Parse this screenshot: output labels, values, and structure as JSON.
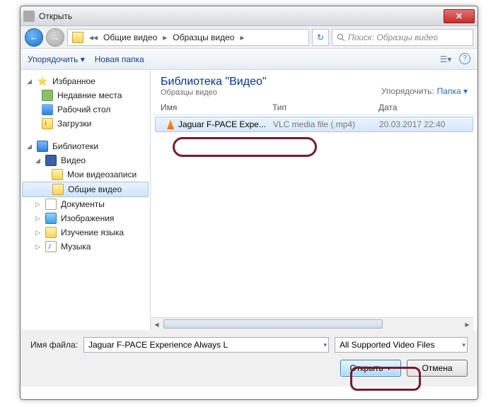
{
  "window": {
    "title": "Открыть"
  },
  "breadcrumb": {
    "seg1": "Общие видео",
    "seg2": "Образцы видео"
  },
  "search": {
    "placeholder": "Поиск: Образцы видео"
  },
  "toolbar": {
    "organize": "Упорядочить ▾",
    "newfolder": "Новая папка"
  },
  "sidebar": {
    "favorites": "Избранное",
    "recent": "Недавние места",
    "desktop": "Рабочий стол",
    "downloads": "Загрузки",
    "libraries": "Библиотеки",
    "video": "Видео",
    "myvideo": "Мои видеозаписи",
    "sharedvideo": "Общие видео",
    "documents": "Документы",
    "images": "Изображения",
    "language": "Изучение языка",
    "music": "Музыка"
  },
  "content": {
    "lib_title": "Библиотека \"Видео\"",
    "lib_sub": "Образцы видео",
    "sort_label": "Упорядочить:",
    "sort_value": "Папка",
    "columns": {
      "name": "Имя",
      "type": "Тип",
      "date": "Дата"
    },
    "file": {
      "name": "Jaguar F-PACE Expe...",
      "type": "VLC media file (.mp4)",
      "date": "20.03.2017 22:40"
    }
  },
  "footer": {
    "filename_label": "Имя файла:",
    "filename_value": "Jaguar F-PACE Experience Always L",
    "filter": "All Supported Video Files",
    "open": "Открыть",
    "cancel": "Отмена"
  }
}
